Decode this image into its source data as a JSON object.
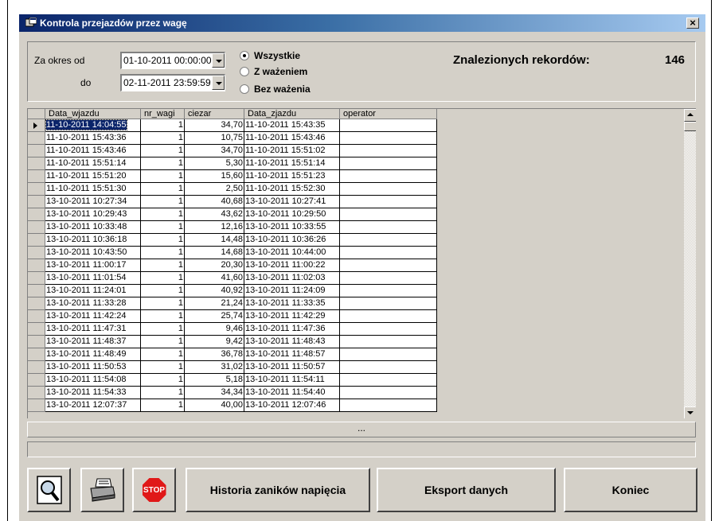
{
  "window": {
    "title": "Kontrola przejazdów przez wagę",
    "close_label": "×"
  },
  "filter": {
    "from_label": "Za okres od",
    "to_label": "do",
    "from_value": "01-10-2011 00:00:00",
    "to_value": "02-11-2011 23:59:59",
    "options": [
      {
        "label": "Wszystkie",
        "checked": true
      },
      {
        "label": "Z ważeniem",
        "checked": false
      },
      {
        "label": "Bez ważenia",
        "checked": false
      }
    ],
    "records_label": "Znalezionych rekordów:",
    "records_count": "146"
  },
  "grid": {
    "columns": [
      "Data_wjazdu",
      "nr_wagi",
      "ciezar",
      "Data_zjazdu",
      "operator"
    ],
    "rows": [
      [
        "11-10-2011 14:04:55",
        "1",
        "34,70",
        "11-10-2011 15:43:35",
        ""
      ],
      [
        "11-10-2011 15:43:36",
        "1",
        "10,75",
        "11-10-2011 15:43:46",
        ""
      ],
      [
        "11-10-2011 15:43:46",
        "1",
        "34,70",
        "11-10-2011 15:51:02",
        ""
      ],
      [
        "11-10-2011 15:51:14",
        "1",
        "5,30",
        "11-10-2011 15:51:14",
        ""
      ],
      [
        "11-10-2011 15:51:20",
        "1",
        "15,60",
        "11-10-2011 15:51:23",
        ""
      ],
      [
        "11-10-2011 15:51:30",
        "1",
        "2,50",
        "11-10-2011 15:52:30",
        ""
      ],
      [
        "13-10-2011 10:27:34",
        "1",
        "40,68",
        "13-10-2011 10:27:41",
        ""
      ],
      [
        "13-10-2011 10:29:43",
        "1",
        "43,62",
        "13-10-2011 10:29:50",
        ""
      ],
      [
        "13-10-2011 10:33:48",
        "1",
        "12,16",
        "13-10-2011 10:33:55",
        ""
      ],
      [
        "13-10-2011 10:36:18",
        "1",
        "14,48",
        "13-10-2011 10:36:26",
        ""
      ],
      [
        "13-10-2011 10:43:50",
        "1",
        "14,68",
        "13-10-2011 10:44:00",
        ""
      ],
      [
        "13-10-2011 11:00:17",
        "1",
        "20,30",
        "13-10-2011 11:00:22",
        ""
      ],
      [
        "13-10-2011 11:01:54",
        "1",
        "41,60",
        "13-10-2011 11:02:03",
        ""
      ],
      [
        "13-10-2011 11:24:01",
        "1",
        "40,92",
        "13-10-2011 11:24:09",
        ""
      ],
      [
        "13-10-2011 11:33:28",
        "1",
        "21,24",
        "13-10-2011 11:33:35",
        ""
      ],
      [
        "13-10-2011 11:42:24",
        "1",
        "25,74",
        "13-10-2011 11:42:29",
        ""
      ],
      [
        "13-10-2011 11:47:31",
        "1",
        "9,46",
        "13-10-2011 11:47:36",
        ""
      ],
      [
        "13-10-2011 11:48:37",
        "1",
        "9,42",
        "13-10-2011 11:48:43",
        ""
      ],
      [
        "13-10-2011 11:48:49",
        "1",
        "36,78",
        "13-10-2011 11:48:57",
        ""
      ],
      [
        "13-10-2011 11:50:53",
        "1",
        "31,02",
        "13-10-2011 11:50:57",
        ""
      ],
      [
        "13-10-2011 11:54:08",
        "1",
        "5,18",
        "13-10-2011 11:54:11",
        ""
      ],
      [
        "13-10-2011 11:54:33",
        "1",
        "34,34",
        "13-10-2011 11:54:40",
        ""
      ],
      [
        "13-10-2011 12:07:37",
        "1",
        "40,00",
        "13-10-2011 12:07:46",
        ""
      ]
    ]
  },
  "more_label": "...",
  "buttons": {
    "preview_icon": "magnifier-preview-icon",
    "print_icon": "printer-icon",
    "stop_label": "STOP",
    "history_label": "Historia zaników napięcia",
    "export_label": "Eksport danych",
    "close_label": "Koniec"
  }
}
